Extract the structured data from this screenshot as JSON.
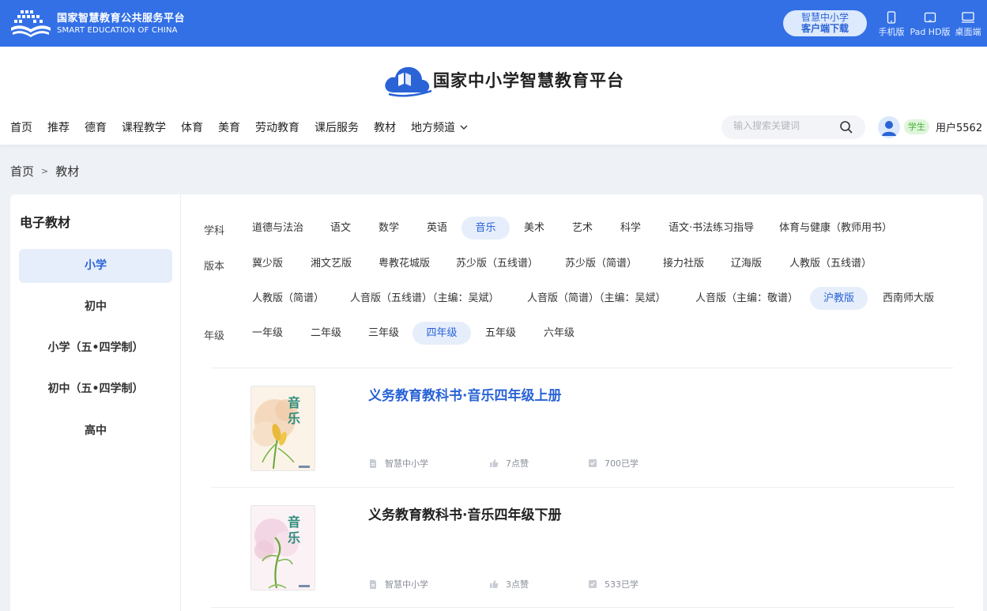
{
  "topbar": {
    "brand_cn": "国家智慧教育公共服务平台",
    "brand_en": "SMART EDUCATION OF CHINA",
    "download_line1": "智慧中小学",
    "download_line2": "客户端下载",
    "devices": [
      {
        "label": "手机版",
        "icon": "phone-icon"
      },
      {
        "label": "Pad HD版",
        "icon": "tablet-icon"
      },
      {
        "label": "桌面端",
        "icon": "desktop-icon"
      }
    ]
  },
  "header": {
    "site_name": "国家中小学智慧教育平台",
    "nav": [
      "首页",
      "推荐",
      "德育",
      "课程教学",
      "体育",
      "美育",
      "劳动教育",
      "课后服务",
      "教材",
      "地方频道"
    ],
    "search_placeholder": "输入搜索关键词",
    "role_badge": "学生",
    "username": "用户5562"
  },
  "breadcrumb": {
    "home": "首页",
    "separator": ">",
    "current": "教材"
  },
  "sidebar": {
    "title": "电子教材",
    "items": [
      "小学",
      "初中",
      "小学（五•四学制）",
      "初中（五•四学制）",
      "高中"
    ],
    "active_index": 0
  },
  "filters": {
    "subject_label": "学科",
    "subjects": [
      "道德与法治",
      "语文",
      "数学",
      "英语",
      "音乐",
      "美术",
      "艺术",
      "科学",
      "语文·书法练习指导",
      "体育与健康（教师用书）"
    ],
    "subject_active": "音乐",
    "edition_label": "版本",
    "editions": [
      "冀少版",
      "湘文艺版",
      "粤教花城版",
      "苏少版（五线谱）",
      "苏少版（简谱）",
      "接力社版",
      "辽海版",
      "人教版（五线谱）",
      "人教版（简谱）",
      "人音版（五线谱）（主编：吴斌）",
      "人音版（简谱）（主编：吴斌）",
      "人音版（主编：敬谱）",
      "沪教版",
      "西南师大版"
    ],
    "edition_active": "沪教版",
    "grade_label": "年级",
    "grades": [
      "一年级",
      "二年级",
      "三年级",
      "四年级",
      "五年级",
      "六年级"
    ],
    "grade_active": "四年级"
  },
  "books": [
    {
      "title": "义务教育教科书·音乐四年级上册",
      "publisher": "智慧中小学",
      "likes": "7点赞",
      "learned": "700已学",
      "cover_title": "音乐",
      "cover_color": "#f5dcc4"
    },
    {
      "title": "义务教育教科书·音乐四年级下册",
      "publisher": "智慧中小学",
      "likes": "3点赞",
      "learned": "533已学",
      "cover_title": "音乐",
      "cover_color": "#f4dde8"
    }
  ],
  "colors": {
    "topbar": "#3370e6",
    "accent": "#2a63d6",
    "active_bg": "#e6eefb",
    "badge_green": "#48b13b"
  }
}
